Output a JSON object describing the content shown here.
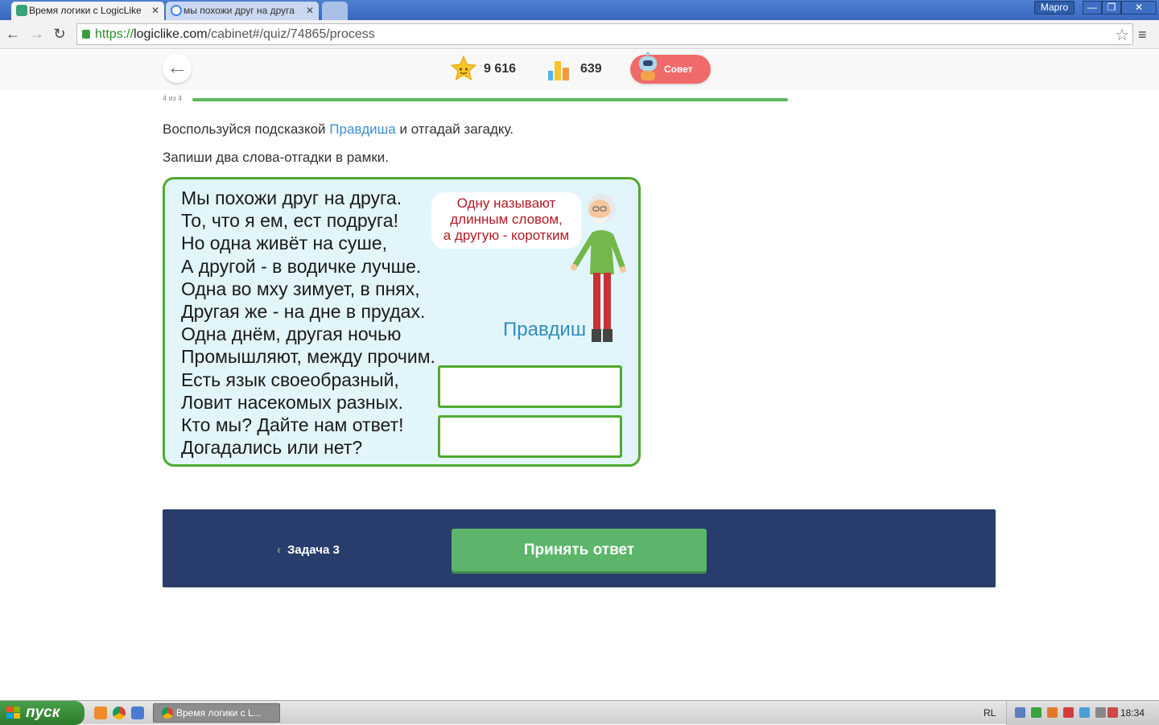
{
  "browser": {
    "tabs": [
      {
        "title": "Время логики с LogicLike",
        "active": true
      },
      {
        "title": "мы похожи друг на друга",
        "active": false
      }
    ],
    "user_name": "Марго",
    "url_scheme": "https://",
    "url_host": "logiclike.com",
    "url_path": "/cabinet#/quiz/74865/process"
  },
  "header": {
    "stars_value": "9 616",
    "rating_value": "639",
    "hint_label": "Совет",
    "progress_label": "4 из 4",
    "progress_fraction": 1.0
  },
  "task": {
    "instruction_before": "Воспользуйся подсказкой ",
    "instruction_highlight": "Правдиша",
    "instruction_after": " и отгадай загадку.",
    "instruction_2": "Запиши два слова-отгадки в рамки.",
    "poem_lines": [
      "Мы похожи друг на друга.",
      "То, что я ем, ест подруга!",
      "Но одна живёт на суше,",
      "А другой - в водичке лучше.",
      "Одна во мху зимует, в пнях,",
      "Другая же - на дне в прудах.",
      "Одна днём, другая ночью",
      "Промышляют, между прочим.",
      "Есть язык своеобразный,",
      "Ловит насекомых разных.",
      "Кто мы? Дайте нам ответ!",
      "Догадались или нет?"
    ],
    "bubble_lines": [
      "Одну называют",
      "длинным словом,",
      "а другую - коротким"
    ],
    "character_name": "Правдиш",
    "answer_1": "",
    "answer_2": ""
  },
  "bottom": {
    "prev_label": "Задача 3",
    "submit_label": "Принять ответ"
  },
  "taskbar": {
    "start_label": "пуск",
    "task_title": "Время логики с L...",
    "lang": "RL",
    "clock": "18:34"
  },
  "colors": {
    "accent_green": "#5cb56a",
    "panel_navy": "#283d6c",
    "hint_red": "#f06a6a",
    "link_blue": "#3c8dd1",
    "card_border": "#4faa2e"
  }
}
